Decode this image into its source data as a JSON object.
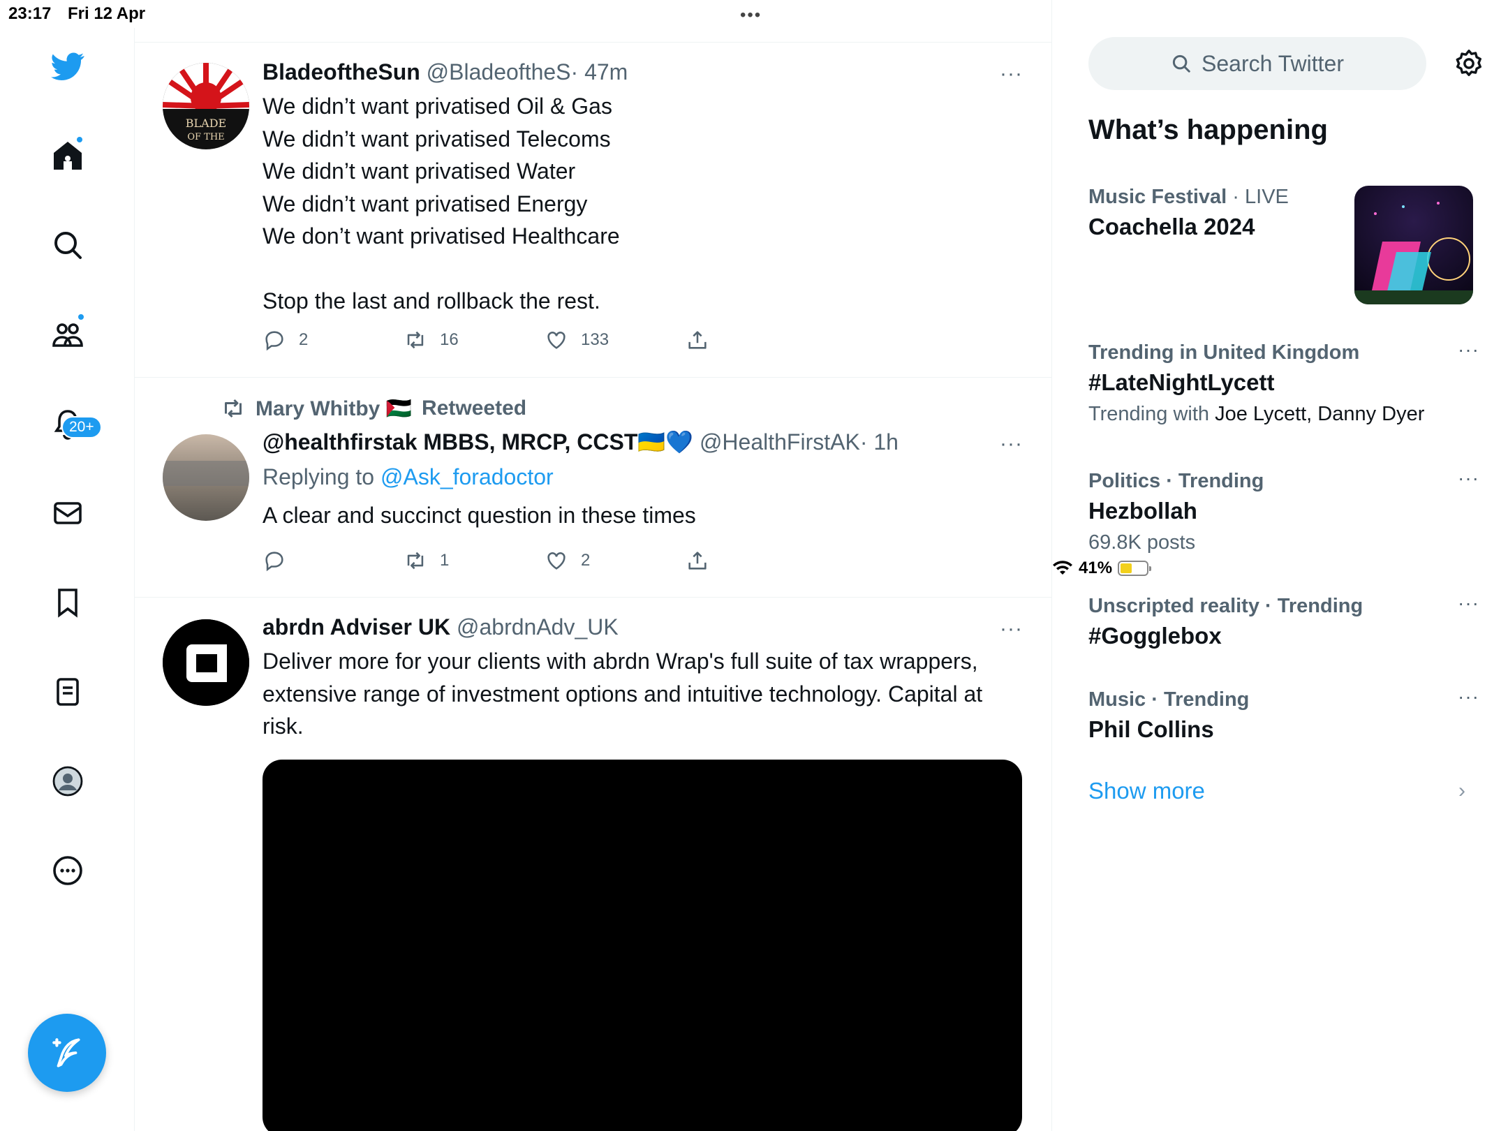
{
  "status_bar": {
    "time": "23:17",
    "date": "Fri 12 Apr",
    "battery": "41%",
    "dots": "•••"
  },
  "left_nav": {
    "notifications_badge": "20+"
  },
  "tweets": [
    {
      "name": "BladeoftheSun",
      "handle": "@BladeoftheS",
      "time": "· 47m",
      "more": "···",
      "avatar_text": "BLADE OF THE",
      "text": "We didn’t want privatised Oil & Gas\nWe didn’t want privatised Telecoms\nWe didn’t want privatised Water\nWe didn’t want privatised Energy\nWe don’t want privatised Healthcare\n\nStop the last and rollback the rest.",
      "replies": "2",
      "retweets": "16",
      "likes": "133"
    },
    {
      "retweeted_by": "Mary Whitby 🇵🇸",
      "retweeted_label": "Retweeted",
      "name": "@healthfirstak MBBS, MRCP, CCST🇺🇦💙",
      "handle": "@HealthFirstAK",
      "time": "· 1h",
      "more": "···",
      "replying_prefix": "Replying to",
      "replying_to": "@Ask_foradoctor",
      "text": "A clear and succinct question in these times",
      "replies": "",
      "retweets": "1",
      "likes": "2"
    },
    {
      "name": "abrdn Adviser UK",
      "handle": "@abrdnAdv_UK",
      "time": "",
      "more": "···",
      "text": "Deliver more for your clients with abrdn Wrap's full suite of tax wrappers, extensive range of investment options and intuitive technology. Capital at risk."
    }
  ],
  "sidebar": {
    "search_placeholder": "Search Twitter",
    "heading": "What’s happening",
    "trends": [
      {
        "category": "Music Festival",
        "extra": " · LIVE",
        "title": "Coachella 2024",
        "sub": ""
      },
      {
        "category": "Trending in United Kingdom",
        "extra": "",
        "title": "#LateNightLycett",
        "sub_prefix": "Trending with ",
        "sub_names": "Joe Lycett, Danny Dyer"
      },
      {
        "category": "Politics · Trending",
        "extra": "",
        "title": "Hezbollah",
        "sub": "69.8K posts"
      },
      {
        "category": "Unscripted reality · Trending",
        "extra": "",
        "title": "#Gogglebox",
        "sub": ""
      },
      {
        "category": "Music · Trending",
        "extra": "",
        "title": "Phil Collins",
        "sub": ""
      }
    ],
    "show_more": "Show more",
    "more": "···",
    "chevron": "›"
  },
  "colors": {
    "accent": "#1d9bf0",
    "text": "#0f1419",
    "secondary": "#536471",
    "border": "#eff3f4"
  }
}
